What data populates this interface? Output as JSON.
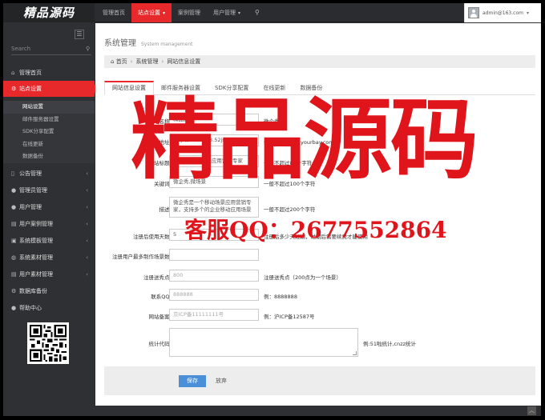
{
  "logo": "精品源码",
  "top_nav": [
    {
      "label": "管理首页",
      "active": false,
      "caret": false
    },
    {
      "label": "站点设置",
      "active": true,
      "caret": true
    },
    {
      "label": "案例管理",
      "active": false,
      "caret": false
    },
    {
      "label": "用户管理",
      "active": false,
      "caret": true
    }
  ],
  "user_email": "admin@163.com",
  "sidebar": {
    "search_placeholder": "Search",
    "items": [
      {
        "label": "管理首页",
        "icon": "home-icon",
        "glyph": "⌂",
        "active": false
      },
      {
        "label": "站点设置",
        "icon": "cogs-icon",
        "glyph": "⚙",
        "active": true
      },
      {
        "label": "公告管理",
        "icon": "bookmark-icon",
        "glyph": "▯",
        "active": false
      },
      {
        "label": "管理员管理",
        "icon": "user-icon",
        "glyph": "●",
        "active": false
      },
      {
        "label": "用户管理",
        "icon": "users-icon",
        "glyph": "●",
        "active": false
      },
      {
        "label": "用户案例管理",
        "icon": "list-icon",
        "glyph": "▤",
        "active": false
      },
      {
        "label": "系统模板管理",
        "icon": "template-icon",
        "glyph": "▣",
        "active": false
      },
      {
        "label": "系统素材管理",
        "icon": "image-icon",
        "glyph": "◍",
        "active": false
      },
      {
        "label": "用户素材管理",
        "icon": "folder-icon",
        "glyph": "▤",
        "active": false
      },
      {
        "label": "数据库备份",
        "icon": "database-icon",
        "glyph": "⚙",
        "active": false
      },
      {
        "label": "帮助中心",
        "icon": "help-icon",
        "glyph": "●",
        "active": false
      }
    ],
    "submenu": [
      {
        "label": "网站设置",
        "active": true
      },
      {
        "label": "邮件服务器设置",
        "active": false
      },
      {
        "label": "SDK分享配置",
        "active": false
      },
      {
        "label": "在线更新",
        "active": false
      },
      {
        "label": "数据备份",
        "active": false
      }
    ]
  },
  "page": {
    "title": "系统管理",
    "subtitle": "System management",
    "breadcrumb": [
      "首页",
      "系统管理",
      "网站信息设置"
    ]
  },
  "tabs": [
    "网站信息设置",
    "邮件服务器设置",
    "SDK分享配置",
    "在线更新",
    "数据备份"
  ],
  "form": {
    "site_name": {
      "label": "网站名称：",
      "value": "精品源码",
      "hint": "微企秀"
    },
    "site_url": {
      "label": "网站地址：",
      "value": "http://www.nc8.52jscn.com",
      "hint": "例:http://www.yourbay.com"
    },
    "site_title": {
      "label": "网站标题：",
      "value": "微企秀-移动场景应用营销专家",
      "hint": "一般不超过80个字符"
    },
    "keywords": {
      "label": "关键词：",
      "value": "微企秀,微场景",
      "hint": "一般不超过100个字符"
    },
    "description": {
      "label": "描述：",
      "value": "微企秀是一个移动场景应用营销专家，支持多个的企业移动应用场景",
      "hint": "一般不超过200个字符"
    },
    "free_days": {
      "label": "注册后使用天数：",
      "value": "5",
      "hint": "注册后多少天过期，过期后需要续费才能使用"
    },
    "max_scenes": {
      "label": "注册用户最多制作场景数：",
      "value": "",
      "hint": ""
    },
    "reg_points": {
      "label": "注册送秀点：",
      "value": "800",
      "hint": "注册送秀点（200点为一个场景）"
    },
    "qq": {
      "label": "联系QQ：",
      "value": "888888",
      "hint": "例：8888888"
    },
    "icp": {
      "label": "网站备案：",
      "value": "京ICP备11111111号",
      "hint": "例：沪ICP备12587号"
    },
    "stats": {
      "label": "统计代码：",
      "value": "",
      "hint": "例:51啦统计,cnzz统计"
    }
  },
  "buttons": {
    "save": "保存",
    "cancel": "放弃"
  },
  "watermark": {
    "big": "精品源码",
    "qq": "客服QQ：2677552864"
  },
  "colors": {
    "accent": "#e8292c",
    "primary_button": "#4b8fd9",
    "watermark": "#e0141b"
  }
}
